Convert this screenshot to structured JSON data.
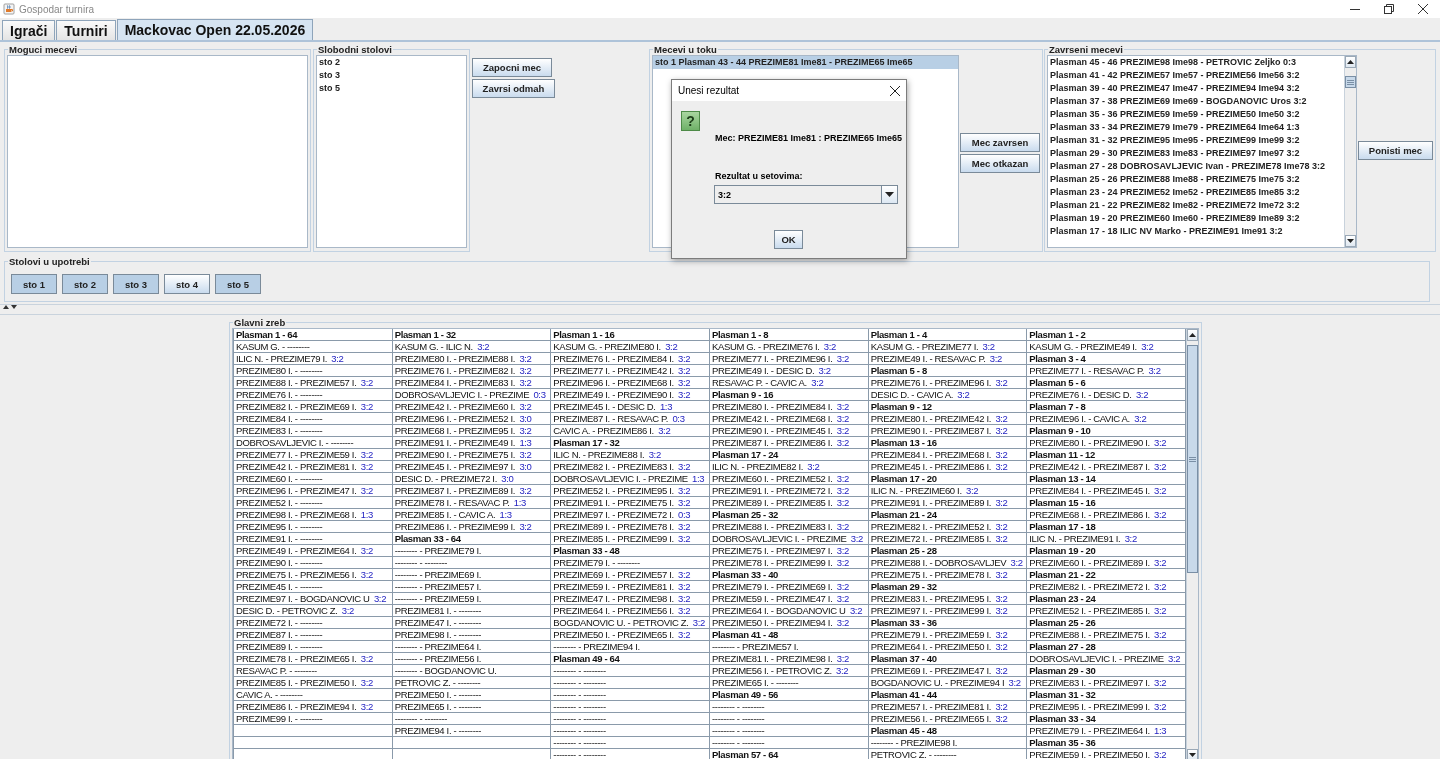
{
  "window": {
    "title": "Gospodar turnira"
  },
  "tabs": [
    {
      "label": "Igrači",
      "selected": false
    },
    {
      "label": "Turniri",
      "selected": false
    },
    {
      "label": "Mackovac Open 22.05.2026",
      "selected": true
    }
  ],
  "possible_matches": {
    "title": "Moguci mecevi"
  },
  "free_tables": {
    "title": "Slobodni stolovi",
    "items": [
      "sto 2",
      "sto 3",
      "sto 5"
    ]
  },
  "table_actions": [
    "Zapocni mec",
    "Zavrsi odmah"
  ],
  "matches_in_progress": {
    "title": "Mecevi u toku",
    "items": [
      {
        "text": "sto 1 Plasman 43 - 44 PREZIME81 Ime81 - PREZIME65 Ime65",
        "selected": true
      }
    ]
  },
  "match_actions": [
    "Mec zavrsen",
    "Mec otkazan"
  ],
  "finished_matches": {
    "title": "Zavrseni mecevi",
    "items": [
      "Plasman 45 - 46 PREZIME98 Ime98 - PETROVIC Zeljko 0:3",
      "Plasman 41 - 42 PREZIME57 Ime57 - PREZIME56 Ime56 3:2",
      "Plasman 39 - 40 PREZIME47 Ime47 - PREZIME94 Ime94 3:2",
      "Plasman 37 - 38 PREZIME69 Ime69 - BOGDANOVIC Uros 3:2",
      "Plasman 35 - 36 PREZIME59 Ime59 - PREZIME50 Ime50 3:2",
      "Plasman 33 - 34 PREZIME79 Ime79 - PREZIME64 Ime64 1:3",
      "Plasman 31 - 32 PREZIME95 Ime95 - PREZIME99 Ime99 3:2",
      "Plasman 29 - 30 PREZIME83 Ime83 - PREZIME97 Ime97 3:2",
      "Plasman 27 - 28 DOBROSAVLJEVIC Ivan - PREZIME78 Ime78 3:2",
      "Plasman 25 - 26 PREZIME88 Ime88 - PREZIME75 Ime75 3:2",
      "Plasman 23 - 24 PREZIME52 Ime52 - PREZIME85 Ime85 3:2",
      "Plasman 21 - 22 PREZIME82 Ime82 - PREZIME72 Ime72 3:2",
      "Plasman 19 - 20 PREZIME60 Ime60 - PREZIME89 Ime89 3:2",
      "Plasman 17 - 18 ILIC NV Marko - PREZIME91 Ime91 3:2"
    ]
  },
  "finished_actions": [
    "Ponisti mec"
  ],
  "tables_in_use": {
    "title": "Stolovi u upotrebi",
    "buttons": [
      {
        "label": "sto 1",
        "highlighted": true
      },
      {
        "label": "sto 2",
        "highlighted": true
      },
      {
        "label": "sto 3",
        "highlighted": true
      },
      {
        "label": "sto 4",
        "highlighted": false
      },
      {
        "label": "sto 5",
        "highlighted": true
      }
    ]
  },
  "bracket": {
    "title": "Glavni zreb",
    "columns": [
      {
        "cells": [
          {
            "kind": "heading",
            "text": "Plasman 1 - 64"
          },
          {
            "kind": "match",
            "text": "KASUM G. - --------"
          },
          {
            "kind": "match",
            "text": "ILIC N. - PREZIME79 I.",
            "score": "3:2"
          },
          {
            "kind": "match",
            "text": "PREZIME80 I. - --------"
          },
          {
            "kind": "match",
            "text": "PREZIME88 I. - PREZIME57 I.",
            "score": "3:2"
          },
          {
            "kind": "match",
            "text": "PREZIME76 I. - --------"
          },
          {
            "kind": "match",
            "text": "PREZIME82 I. - PREZIME69 I.",
            "score": "3:2"
          },
          {
            "kind": "match",
            "text": "PREZIME84 I. - --------"
          },
          {
            "kind": "match",
            "text": "PREZIME83 I. - --------"
          },
          {
            "kind": "match",
            "text": "DOBROSAVLJEVIC I. - --------"
          },
          {
            "kind": "match",
            "text": "PREZIME77 I. - PREZIME59 I.",
            "score": "3:2"
          },
          {
            "kind": "match",
            "text": "PREZIME42 I. - PREZIME81 I.",
            "score": "3:2"
          },
          {
            "kind": "match",
            "text": "PREZIME60 I. - --------"
          },
          {
            "kind": "match",
            "text": "PREZIME96 I. - PREZIME47 I.",
            "score": "3:2"
          },
          {
            "kind": "match",
            "text": "PREZIME52 I. - --------"
          },
          {
            "kind": "match",
            "text": "PREZIME98 I. - PREZIME68 I.",
            "score": "1:3"
          },
          {
            "kind": "match",
            "text": "PREZIME95 I. - --------"
          },
          {
            "kind": "match",
            "text": "PREZIME91 I. - --------"
          },
          {
            "kind": "match",
            "text": "PREZIME49 I. - PREZIME64 I.",
            "score": "3:2"
          },
          {
            "kind": "match",
            "text": "PREZIME90 I. - --------"
          },
          {
            "kind": "match",
            "text": "PREZIME75 I. - PREZIME56 I.",
            "score": "3:2"
          },
          {
            "kind": "match",
            "text": "PREZIME45 I. - --------"
          },
          {
            "kind": "match",
            "text": "PREZIME97 I. - BOGDANOVIC U",
            "score": "3:2"
          },
          {
            "kind": "match",
            "text": "DESIC D. - PETROVIC Z.",
            "score": "3:2"
          },
          {
            "kind": "match",
            "text": "PREZIME72 I. - --------"
          },
          {
            "kind": "match",
            "text": "PREZIME87 I. - --------"
          },
          {
            "kind": "match",
            "text": "PREZIME89 I. - --------"
          },
          {
            "kind": "match",
            "text": "PREZIME78 I. - PREZIME65 I.",
            "score": "3:2"
          },
          {
            "kind": "match",
            "text": "RESAVAC P. - --------"
          },
          {
            "kind": "match",
            "text": "PREZIME85 I. - PREZIME50 I.",
            "score": "3:2"
          },
          {
            "kind": "match",
            "text": "CAVIC A. - --------"
          },
          {
            "kind": "match",
            "text": "PREZIME86 I. - PREZIME94 I.",
            "score": "3:2"
          },
          {
            "kind": "match",
            "text": "PREZIME99 I. - --------"
          },
          {
            "kind": "empty"
          },
          {
            "kind": "empty"
          },
          {
            "kind": "empty"
          }
        ]
      },
      {
        "cells": [
          {
            "kind": "heading",
            "text": "Plasman 1 - 32"
          },
          {
            "kind": "match",
            "text": "KASUM G. - ILIC N.",
            "score": "3:2"
          },
          {
            "kind": "match",
            "text": "PREZIME80 I. - PREZIME88 I.",
            "score": "3:2"
          },
          {
            "kind": "match",
            "text": "PREZIME76 I. - PREZIME82 I.",
            "score": "3:2"
          },
          {
            "kind": "match",
            "text": "PREZIME84 I. - PREZIME83 I.",
            "score": "3:2"
          },
          {
            "kind": "match",
            "text": "DOBROSAVLJEVIC I. - PREZIME",
            "score": "0:3"
          },
          {
            "kind": "match",
            "text": "PREZIME42 I. - PREZIME60 I.",
            "score": "3:2"
          },
          {
            "kind": "match",
            "text": "PREZIME96 I. - PREZIME52 I.",
            "score": "3:0"
          },
          {
            "kind": "match",
            "text": "PREZIME68 I. - PREZIME95 I.",
            "score": "3:2"
          },
          {
            "kind": "match",
            "text": "PREZIME91 I. - PREZIME49 I.",
            "score": "1:3"
          },
          {
            "kind": "match",
            "text": "PREZIME90 I. - PREZIME75 I.",
            "score": "3:2"
          },
          {
            "kind": "match",
            "text": "PREZIME45 I. - PREZIME97 I.",
            "score": "3:0"
          },
          {
            "kind": "match",
            "text": "DESIC D. - PREZIME72 I.",
            "score": "3:0"
          },
          {
            "kind": "match",
            "text": "PREZIME87 I. - PREZIME89 I.",
            "score": "3:2"
          },
          {
            "kind": "match",
            "text": "PREZIME78 I. - RESAVAC P.",
            "score": "1:3"
          },
          {
            "kind": "match",
            "text": "PREZIME85 I. - CAVIC A.",
            "score": "1:3"
          },
          {
            "kind": "match",
            "text": "PREZIME86 I. - PREZIME99 I.",
            "score": "3:2"
          },
          {
            "kind": "heading",
            "text": "Plasman 33 - 64"
          },
          {
            "kind": "match",
            "text": "-------- - PREZIME79 I."
          },
          {
            "kind": "match",
            "text": "-------- - --------"
          },
          {
            "kind": "match",
            "text": "-------- - PREZIME69 I."
          },
          {
            "kind": "match",
            "text": "-------- - PREZIME57 I."
          },
          {
            "kind": "match",
            "text": "-------- - PREZIME59 I."
          },
          {
            "kind": "match",
            "text": "PREZIME81 I. - --------"
          },
          {
            "kind": "match",
            "text": "PREZIME47 I. - --------"
          },
          {
            "kind": "match",
            "text": "PREZIME98 I. - --------"
          },
          {
            "kind": "match",
            "text": "-------- - PREZIME64 I."
          },
          {
            "kind": "match",
            "text": "-------- - PREZIME56 I."
          },
          {
            "kind": "match",
            "text": "-------- - BOGDANOVIC U."
          },
          {
            "kind": "match",
            "text": "PETROVIC Z. - --------"
          },
          {
            "kind": "match",
            "text": "PREZIME50 I. - --------"
          },
          {
            "kind": "match",
            "text": "PREZIME65 I. - --------"
          },
          {
            "kind": "match",
            "text": "-------- - --------"
          },
          {
            "kind": "match",
            "text": "PREZIME94 I. - --------"
          },
          {
            "kind": "empty"
          },
          {
            "kind": "empty"
          }
        ]
      },
      {
        "cells": [
          {
            "kind": "heading",
            "text": "Plasman 1 - 16"
          },
          {
            "kind": "match",
            "text": "KASUM G. - PREZIME80 I.",
            "score": "3:2"
          },
          {
            "kind": "match",
            "text": "PREZIME76 I. - PREZIME84 I.",
            "score": "3:2"
          },
          {
            "kind": "match",
            "text": "PREZIME77 I. - PREZIME42 I.",
            "score": "3:2"
          },
          {
            "kind": "match",
            "text": "PREZIME96 I. - PREZIME68 I.",
            "score": "3:2"
          },
          {
            "kind": "match",
            "text": "PREZIME49 I. - PREZIME90 I.",
            "score": "3:2"
          },
          {
            "kind": "match",
            "text": "PREZIME45 I. - DESIC D.",
            "score": "1:3"
          },
          {
            "kind": "match",
            "text": "PREZIME87 I. - RESAVAC P.",
            "score": "0:3"
          },
          {
            "kind": "match",
            "text": "CAVIC A. - PREZIME86 I.",
            "score": "3:2"
          },
          {
            "kind": "heading",
            "text": "Plasman 17 - 32"
          },
          {
            "kind": "match",
            "text": "ILIC N. - PREZIME88 I.",
            "score": "3:2"
          },
          {
            "kind": "match",
            "text": "PREZIME82 I. - PREZIME83 I.",
            "score": "3:2"
          },
          {
            "kind": "match",
            "text": "DOBROSAVLJEVIC I. - PREZIME",
            "score": "1:3"
          },
          {
            "kind": "match",
            "text": "PREZIME52 I. - PREZIME95 I.",
            "score": "3:2"
          },
          {
            "kind": "match",
            "text": "PREZIME91 I. - PREZIME75 I.",
            "score": "3:2"
          },
          {
            "kind": "match",
            "text": "PREZIME97 I. - PREZIME72 I.",
            "score": "0:3"
          },
          {
            "kind": "match",
            "text": "PREZIME89 I. - PREZIME78 I.",
            "score": "3:2"
          },
          {
            "kind": "match",
            "text": "PREZIME85 I. - PREZIME99 I.",
            "score": "3:2"
          },
          {
            "kind": "heading",
            "text": "Plasman 33 - 48"
          },
          {
            "kind": "match",
            "text": "PREZIME79 I. - --------"
          },
          {
            "kind": "match",
            "text": "PREZIME69 I. - PREZIME57 I.",
            "score": "3:2"
          },
          {
            "kind": "match",
            "text": "PREZIME59 I. - PREZIME81 I.",
            "score": "3:2"
          },
          {
            "kind": "match",
            "text": "PREZIME47 I. - PREZIME98 I.",
            "score": "3:2"
          },
          {
            "kind": "match",
            "text": "PREZIME64 I. - PREZIME56 I.",
            "score": "3:2"
          },
          {
            "kind": "match",
            "text": "BOGDANOVIC U. - PETROVIC Z.",
            "score": "3:2"
          },
          {
            "kind": "match",
            "text": "PREZIME50 I. - PREZIME65 I.",
            "score": "3:2"
          },
          {
            "kind": "match",
            "text": "-------- - PREZIME94 I."
          },
          {
            "kind": "heading",
            "text": "Plasman 49 - 64"
          },
          {
            "kind": "match",
            "text": "-------- - --------"
          },
          {
            "kind": "match",
            "text": "-------- - --------"
          },
          {
            "kind": "match",
            "text": "-------- - --------"
          },
          {
            "kind": "match",
            "text": "-------- - --------"
          },
          {
            "kind": "match",
            "text": "-------- - --------"
          },
          {
            "kind": "match",
            "text": "-------- - --------"
          },
          {
            "kind": "match",
            "text": "-------- - --------"
          },
          {
            "kind": "match",
            "text": "-------- - --------"
          }
        ]
      },
      {
        "cells": [
          {
            "kind": "heading",
            "text": "Plasman 1 - 8"
          },
          {
            "kind": "match",
            "text": "KASUM G. - PREZIME76 I.",
            "score": "3:2"
          },
          {
            "kind": "match",
            "text": "PREZIME77 I. - PREZIME96 I.",
            "score": "3:2"
          },
          {
            "kind": "match",
            "text": "PREZIME49 I. - DESIC D.",
            "score": "3:2"
          },
          {
            "kind": "match",
            "text": "RESAVAC P. - CAVIC A.",
            "score": "3:2"
          },
          {
            "kind": "heading",
            "text": "Plasman 9 - 16"
          },
          {
            "kind": "match",
            "text": "PREZIME80 I. - PREZIME84 I.",
            "score": "3:2"
          },
          {
            "kind": "match",
            "text": "PREZIME42 I. - PREZIME68 I.",
            "score": "3:2"
          },
          {
            "kind": "match",
            "text": "PREZIME90 I. - PREZIME45 I.",
            "score": "3:2"
          },
          {
            "kind": "match",
            "text": "PREZIME87 I. - PREZIME86 I.",
            "score": "3:2"
          },
          {
            "kind": "heading",
            "text": "Plasman 17 - 24"
          },
          {
            "kind": "match",
            "text": "ILIC N. - PREZIME82 I.",
            "score": "3:2"
          },
          {
            "kind": "match",
            "text": "PREZIME60 I. - PREZIME52 I.",
            "score": "3:2"
          },
          {
            "kind": "match",
            "text": "PREZIME91 I. - PREZIME72 I.",
            "score": "3:2"
          },
          {
            "kind": "match",
            "text": "PREZIME89 I. - PREZIME85 I.",
            "score": "3:2"
          },
          {
            "kind": "heading",
            "text": "Plasman 25 - 32"
          },
          {
            "kind": "match",
            "text": "PREZIME88 I. - PREZIME83 I.",
            "score": "3:2"
          },
          {
            "kind": "match",
            "text": "DOBROSAVLJEVIC I. - PREZIME",
            "score": "3:2"
          },
          {
            "kind": "match",
            "text": "PREZIME75 I. - PREZIME97 I.",
            "score": "3:2"
          },
          {
            "kind": "match",
            "text": "PREZIME78 I. - PREZIME99 I.",
            "score": "3:2"
          },
          {
            "kind": "heading",
            "text": "Plasman 33 - 40"
          },
          {
            "kind": "match",
            "text": "PREZIME79 I. - PREZIME69 I.",
            "score": "3:2"
          },
          {
            "kind": "match",
            "text": "PREZIME59 I. - PREZIME47 I.",
            "score": "3:2"
          },
          {
            "kind": "match",
            "text": "PREZIME64 I. - BOGDANOVIC U",
            "score": "3:2"
          },
          {
            "kind": "match",
            "text": "PREZIME50 I. - PREZIME94 I.",
            "score": "3:2"
          },
          {
            "kind": "heading",
            "text": "Plasman 41 - 48"
          },
          {
            "kind": "match",
            "text": "-------- - PREZIME57 I."
          },
          {
            "kind": "match",
            "text": "PREZIME81 I. - PREZIME98 I.",
            "score": "3:2"
          },
          {
            "kind": "match",
            "text": "PREZIME56 I. - PETROVIC Z.",
            "score": "3:2"
          },
          {
            "kind": "match",
            "text": "PREZIME65 I. - --------"
          },
          {
            "kind": "heading",
            "text": "Plasman 49 - 56"
          },
          {
            "kind": "match",
            "text": "-------- - --------"
          },
          {
            "kind": "match",
            "text": "-------- - --------"
          },
          {
            "kind": "match",
            "text": "-------- - --------"
          },
          {
            "kind": "match",
            "text": "-------- - --------"
          },
          {
            "kind": "heading",
            "text": "Plasman 57 - 64"
          }
        ]
      },
      {
        "cells": [
          {
            "kind": "heading",
            "text": "Plasman 1 - 4"
          },
          {
            "kind": "match",
            "text": "KASUM G. - PREZIME77 I.",
            "score": "3:2"
          },
          {
            "kind": "match",
            "text": "PREZIME49 I. - RESAVAC P.",
            "score": "3:2"
          },
          {
            "kind": "heading",
            "text": "Plasman 5 - 8"
          },
          {
            "kind": "match",
            "text": "PREZIME76 I. - PREZIME96 I.",
            "score": "3:2"
          },
          {
            "kind": "match",
            "text": "DESIC D. - CAVIC A.",
            "score": "3:2"
          },
          {
            "kind": "heading",
            "text": "Plasman 9 - 12"
          },
          {
            "kind": "match",
            "text": "PREZIME80 I. - PREZIME42 I.",
            "score": "3:2"
          },
          {
            "kind": "match",
            "text": "PREZIME90 I. - PREZIME87 I.",
            "score": "3:2"
          },
          {
            "kind": "heading",
            "text": "Plasman 13 - 16"
          },
          {
            "kind": "match",
            "text": "PREZIME84 I. - PREZIME68 I.",
            "score": "3:2"
          },
          {
            "kind": "match",
            "text": "PREZIME45 I. - PREZIME86 I.",
            "score": "3:2"
          },
          {
            "kind": "heading",
            "text": "Plasman 17 - 20"
          },
          {
            "kind": "match",
            "text": "ILIC N. - PREZIME60 I.",
            "score": "3:2"
          },
          {
            "kind": "match",
            "text": "PREZIME91 I. - PREZIME89 I.",
            "score": "3:2"
          },
          {
            "kind": "heading",
            "text": "Plasman 21 - 24"
          },
          {
            "kind": "match",
            "text": "PREZIME82 I. - PREZIME52 I.",
            "score": "3:2"
          },
          {
            "kind": "match",
            "text": "PREZIME72 I. - PREZIME85 I.",
            "score": "3:2"
          },
          {
            "kind": "heading",
            "text": "Plasman 25 - 28"
          },
          {
            "kind": "match",
            "text": "PREZIME88 I. - DOBROSAVLJEV",
            "score": "3:2"
          },
          {
            "kind": "match",
            "text": "PREZIME75 I. - PREZIME78 I.",
            "score": "3:2"
          },
          {
            "kind": "heading",
            "text": "Plasman 29 - 32"
          },
          {
            "kind": "match",
            "text": "PREZIME83 I. - PREZIME95 I.",
            "score": "3:2"
          },
          {
            "kind": "match",
            "text": "PREZIME97 I. - PREZIME99 I.",
            "score": "3:2"
          },
          {
            "kind": "heading",
            "text": "Plasman 33 - 36"
          },
          {
            "kind": "match",
            "text": "PREZIME79 I. - PREZIME59 I.",
            "score": "3:2"
          },
          {
            "kind": "match",
            "text": "PREZIME64 I. - PREZIME50 I.",
            "score": "3:2"
          },
          {
            "kind": "heading",
            "text": "Plasman 37 - 40"
          },
          {
            "kind": "match",
            "text": "PREZIME69 I. - PREZIME47 I.",
            "score": "3:2"
          },
          {
            "kind": "match",
            "text": "BOGDANOVIC U. - PREZIME94 I",
            "score": "3:2"
          },
          {
            "kind": "heading",
            "text": "Plasman 41 - 44"
          },
          {
            "kind": "match",
            "text": "PREZIME57 I. - PREZIME81 I.",
            "score": "3:2"
          },
          {
            "kind": "match",
            "text": "PREZIME56 I. - PREZIME65 I.",
            "score": "3:2"
          },
          {
            "kind": "heading",
            "text": "Plasman 45 - 48"
          },
          {
            "kind": "match",
            "text": "-------- - PREZIME98 I."
          },
          {
            "kind": "match",
            "text": "PETROVIC Z. - --------"
          }
        ]
      },
      {
        "cells": [
          {
            "kind": "heading",
            "text": "Plasman 1 - 2"
          },
          {
            "kind": "match",
            "text": "KASUM G. - PREZIME49 I.",
            "score": "3:2"
          },
          {
            "kind": "heading",
            "text": "Plasman 3 - 4"
          },
          {
            "kind": "match",
            "text": "PREZIME77 I. - RESAVAC P.",
            "score": "3:2"
          },
          {
            "kind": "heading",
            "text": "Plasman 5 - 6"
          },
          {
            "kind": "match",
            "text": "PREZIME76 I. - DESIC D.",
            "score": "3:2"
          },
          {
            "kind": "heading",
            "text": "Plasman 7 - 8"
          },
          {
            "kind": "match",
            "text": "PREZIME96 I. - CAVIC A.",
            "score": "3:2"
          },
          {
            "kind": "heading",
            "text": "Plasman 9 - 10"
          },
          {
            "kind": "match",
            "text": "PREZIME80 I. - PREZIME90 I.",
            "score": "3:2"
          },
          {
            "kind": "heading",
            "text": "Plasman 11 - 12"
          },
          {
            "kind": "match",
            "text": "PREZIME42 I. - PREZIME87 I.",
            "score": "3:2"
          },
          {
            "kind": "heading",
            "text": "Plasman 13 - 14"
          },
          {
            "kind": "match",
            "text": "PREZIME84 I. - PREZIME45 I.",
            "score": "3:2"
          },
          {
            "kind": "heading",
            "text": "Plasman 15 - 16"
          },
          {
            "kind": "match",
            "text": "PREZIME68 I. - PREZIME86 I.",
            "score": "3:2"
          },
          {
            "kind": "heading",
            "text": "Plasman 17 - 18"
          },
          {
            "kind": "match",
            "text": "ILIC N. - PREZIME91 I.",
            "score": "3:2"
          },
          {
            "kind": "heading",
            "text": "Plasman 19 - 20"
          },
          {
            "kind": "match",
            "text": "PREZIME60 I. - PREZIME89 I.",
            "score": "3:2"
          },
          {
            "kind": "heading",
            "text": "Plasman 21 - 22"
          },
          {
            "kind": "match",
            "text": "PREZIME82 I. - PREZIME72 I.",
            "score": "3:2"
          },
          {
            "kind": "heading",
            "text": "Plasman 23 - 24"
          },
          {
            "kind": "match",
            "text": "PREZIME52 I. - PREZIME85 I.",
            "score": "3:2"
          },
          {
            "kind": "heading",
            "text": "Plasman 25 - 26"
          },
          {
            "kind": "match",
            "text": "PREZIME88 I. - PREZIME75 I.",
            "score": "3:2"
          },
          {
            "kind": "heading",
            "text": "Plasman 27 - 28"
          },
          {
            "kind": "match",
            "text": "DOBROSAVLJEVIC I. - PREZIME",
            "score": "3:2"
          },
          {
            "kind": "heading",
            "text": "Plasman 29 - 30"
          },
          {
            "kind": "match",
            "text": "PREZIME83 I. - PREZIME97 I.",
            "score": "3:2"
          },
          {
            "kind": "heading",
            "text": "Plasman 31 - 32"
          },
          {
            "kind": "match",
            "text": "PREZIME95 I. - PREZIME99 I.",
            "score": "3:2"
          },
          {
            "kind": "heading",
            "text": "Plasman 33 - 34"
          },
          {
            "kind": "match",
            "text": "PREZIME79 I. - PREZIME64 I.",
            "score": "1:3"
          },
          {
            "kind": "heading",
            "text": "Plasman 35 - 36"
          },
          {
            "kind": "match",
            "text": "PREZIME59 I. - PREZIME50 I.",
            "score": "3:2"
          }
        ]
      }
    ]
  },
  "dialog": {
    "title": "Unesi rezultat",
    "icon_glyph": "?",
    "message": "Mec: PREZIME81 Ime81 : PREZIME65 Ime65",
    "field_label": "Rezultat u setovima:",
    "value": "3:2",
    "button": "OK"
  }
}
